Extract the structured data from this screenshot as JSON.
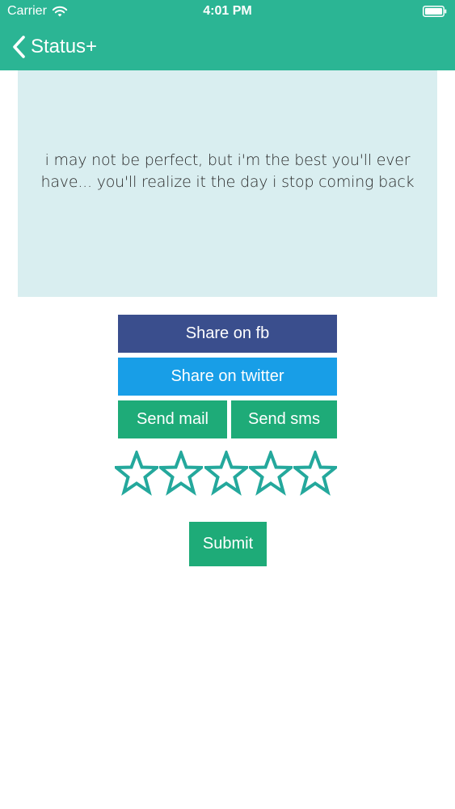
{
  "status_bar": {
    "carrier": "Carrier",
    "time": "4:01 PM"
  },
  "nav": {
    "title": "Status+"
  },
  "quote": {
    "text": "i may not be perfect, but i'm the best you'll ever have... you'll realize it the day i stop coming back"
  },
  "actions": {
    "share_fb": "Share on fb",
    "share_twitter": "Share on twitter",
    "send_mail": "Send mail",
    "send_sms": "Send sms",
    "submit": "Submit"
  },
  "rating": {
    "max": 5,
    "value": 0
  },
  "colors": {
    "header": "#2bb594",
    "card": "#d9eef0",
    "facebook": "#3a4e8d",
    "twitter": "#189ee7",
    "green": "#1eab78",
    "star_outline": "#24a89c"
  },
  "icons": {
    "wifi": "wifi-icon",
    "battery": "battery-icon",
    "back": "chevron-left-icon",
    "star": "star-outline-icon"
  }
}
